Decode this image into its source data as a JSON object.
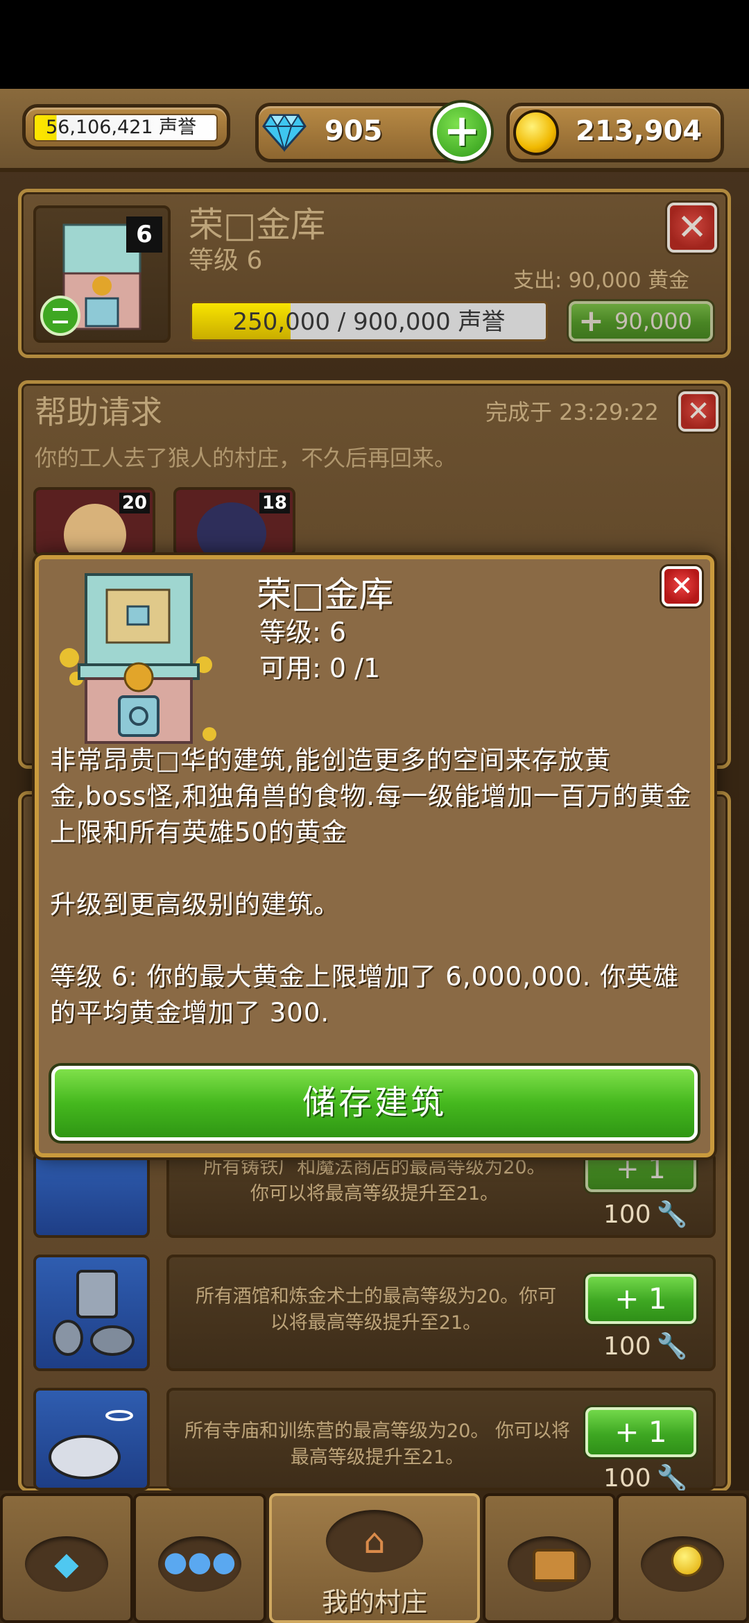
{
  "top_bar": {
    "fame": "56,106,421 声誉",
    "gems": "905",
    "gold": "213,904"
  },
  "vault_panel": {
    "title": "荣□金库",
    "level": "等级 6",
    "badge_level": "6",
    "expense": "支出: 90,000 黄金",
    "progress_text": "250,000 / 900,000 声誉",
    "progress_fraction": 0.278,
    "upgrade_cost": "90,000"
  },
  "help_panel": {
    "title": "帮助请求",
    "completed": "完成于 23:29:22",
    "message": "你的工人去了狼人的村庄，不久后再回来。",
    "heroes": [
      {
        "level": "20"
      },
      {
        "level": "18"
      }
    ]
  },
  "upgrades": [
    {
      "text": "所有铸铁厂和魔法商店的最高等级为20。 你可以将最高等级提升至21。",
      "button": "+ 1",
      "cost": "100"
    },
    {
      "text": "所有酒馆和炼金术士的最高等级为20。你可以将最高等级提升至21。",
      "button": "+ 1",
      "cost": "100"
    },
    {
      "text": "所有寺庙和训练营的最高等级为20。 你可以将最高等级提升至21。",
      "button": "+ 1",
      "cost": "100"
    }
  ],
  "dialog": {
    "title": "荣□金库",
    "level": "等级: 6",
    "available": "可用: 0 /1",
    "description": "非常昂贵□华的建筑,能创造更多的空间来存放黄金,boss怪,和独角兽的食物.每一级能增加一百万的黄金上限和所有英雄50的黄金\n\n升级到更高级别的建筑。\n\n等级 6: 你的最大黄金上限增加了 6,000,000. 你英雄的平均黄金增加了 300.",
    "store_button": "储存建筑"
  },
  "bottom_nav": {
    "items": [
      {
        "icon": "diamond-icon",
        "label": ""
      },
      {
        "icon": "heroes-icon",
        "label": ""
      },
      {
        "icon": "house-icon",
        "label": "我的村庄"
      },
      {
        "icon": "chest-icon",
        "label": ""
      },
      {
        "icon": "medal-icon",
        "label": ""
      }
    ]
  },
  "colors": {
    "accent_green": "#3ea722",
    "panel_gold": "#b0893e",
    "dialog_bg": "#8a6a45",
    "close_red": "#b51818"
  }
}
